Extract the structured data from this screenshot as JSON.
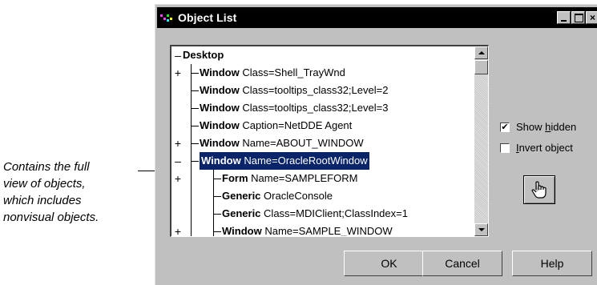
{
  "annotation": {
    "lines": [
      "Contains the full",
      "view of objects,",
      "which includes",
      "nonvisual objects."
    ]
  },
  "dialog": {
    "title": "Object List",
    "title_icon": "object-list-icon",
    "window_controls": [
      "minimize-icon",
      "maximize-icon",
      "close-icon"
    ]
  },
  "tree": {
    "root": "Desktop",
    "nodes": [
      {
        "expander": "+",
        "type": "Window",
        "detail": "Class=Shell_TrayWnd",
        "level": 1,
        "selected": false
      },
      {
        "expander": "",
        "type": "Window",
        "detail": "Class=tooltips_class32;Level=2",
        "level": 1,
        "selected": false
      },
      {
        "expander": "",
        "type": "Window",
        "detail": "Class=tooltips_class32;Level=3",
        "level": 1,
        "selected": false
      },
      {
        "expander": "",
        "type": "Window",
        "detail": "Caption=NetDDE Agent",
        "level": 1,
        "selected": false
      },
      {
        "expander": "+",
        "type": "Window",
        "detail": "Name=ABOUT_WINDOW",
        "level": 1,
        "selected": false
      },
      {
        "expander": "–",
        "type": "Window",
        "detail": "Name=OracleRootWindow",
        "level": 1,
        "selected": true
      },
      {
        "expander": "+",
        "type": "Form",
        "detail": "Name=SAMPLEFORM",
        "level": 2,
        "selected": false
      },
      {
        "expander": "",
        "type": "Generic",
        "detail": "OracleConsole",
        "level": 2,
        "selected": false
      },
      {
        "expander": "",
        "type": "Generic",
        "detail": "Class=MDIClient;ClassIndex=1",
        "level": 2,
        "selected": false
      },
      {
        "expander": "+",
        "type": "Window",
        "detail": "Name=SAMPLE_WINDOW",
        "level": 2,
        "selected": false
      }
    ]
  },
  "options": {
    "show_hidden": {
      "pre": "Show ",
      "accel": "h",
      "post": "idden",
      "checked": true,
      "mark": "✔"
    },
    "invert_object": {
      "pre": "",
      "accel": "I",
      "post": "nvert object",
      "checked": false,
      "mark": ""
    }
  },
  "pointer_button": {
    "icon": "hand-pointer-icon"
  },
  "buttons": {
    "ok": "OK",
    "cancel": "Cancel",
    "help": "Help"
  },
  "colors": {
    "selection": "#0a246a",
    "dialog_bg": "#c0c0c0",
    "titlebar": "#000000"
  }
}
